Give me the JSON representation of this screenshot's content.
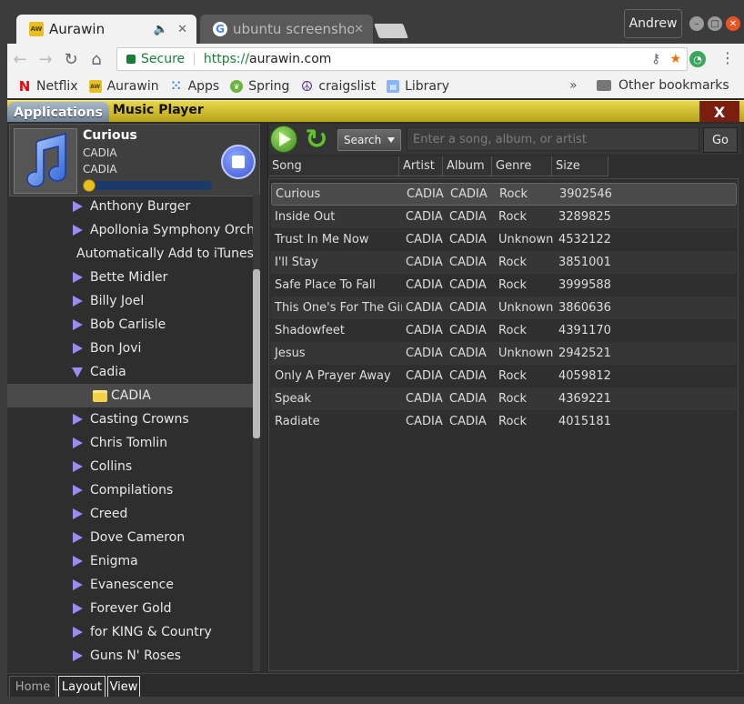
{
  "browser": {
    "tabs": [
      {
        "title": "Aurawin",
        "favicon": "aurawin-icon",
        "active": true
      },
      {
        "title": "ubuntu screenshot",
        "favicon": "google-icon",
        "active": false
      }
    ],
    "profile": "Andrew",
    "address": {
      "secure_label": "Secure",
      "scheme": "https://",
      "host": "aurawin.com"
    },
    "bookmarks": [
      "Netflix",
      "Aurawin",
      "Apps",
      "Spring",
      "craigslist",
      "Library"
    ],
    "bookmarks_more": "»",
    "other_bookmarks": "Other bookmarks"
  },
  "app": {
    "applications_label": "Applications",
    "title": "Music Player",
    "close_label": "X"
  },
  "now_playing": {
    "title": "Curious",
    "artist": "CADIA",
    "album": "CADIA",
    "progress": 0.02
  },
  "tree": [
    {
      "label": "Anthony Burger",
      "kind": "artist"
    },
    {
      "label": "Apollonia Symphony Orchestra",
      "kind": "artist"
    },
    {
      "label": "Automatically Add to iTunes",
      "kind": "folder"
    },
    {
      "label": "Bette Midler",
      "kind": "artist"
    },
    {
      "label": "Billy Joel",
      "kind": "artist"
    },
    {
      "label": "Bob Carlisle",
      "kind": "artist"
    },
    {
      "label": "Bon Jovi",
      "kind": "artist"
    },
    {
      "label": "Cadia",
      "kind": "artist-open"
    },
    {
      "label": "CADIA",
      "kind": "subfolder",
      "selected": true
    },
    {
      "label": "Casting Crowns",
      "kind": "artist"
    },
    {
      "label": "Chris Tomlin",
      "kind": "artist"
    },
    {
      "label": "Collins",
      "kind": "artist"
    },
    {
      "label": "Compilations",
      "kind": "artist"
    },
    {
      "label": "Creed",
      "kind": "artist"
    },
    {
      "label": "Dove Cameron",
      "kind": "artist"
    },
    {
      "label": "Enigma",
      "kind": "artist"
    },
    {
      "label": "Evanescence",
      "kind": "artist"
    },
    {
      "label": "Forever Gold",
      "kind": "artist"
    },
    {
      "label": "for KING & Country",
      "kind": "artist"
    },
    {
      "label": "Guns N' Roses",
      "kind": "artist"
    }
  ],
  "search": {
    "mode": "Search",
    "placeholder": "Enter a song, album, or artist",
    "go_label": "Go"
  },
  "table": {
    "columns": [
      "Song",
      "Artist",
      "Album",
      "Genre",
      "Size"
    ],
    "rows": [
      [
        "Curious",
        "CADIA",
        "CADIA",
        "Rock",
        "3902546"
      ],
      [
        "Inside Out",
        "CADIA",
        "CADIA",
        "Rock",
        "3289825"
      ],
      [
        "Trust In Me Now",
        "CADIA",
        "CADIA",
        "Unknown",
        "4532122"
      ],
      [
        "I'll Stay",
        "CADIA",
        "CADIA",
        "Rock",
        "3851001"
      ],
      [
        "Safe Place To Fall",
        "CADIA",
        "CADIA",
        "Rock",
        "3999588"
      ],
      [
        "This One's For The Girls",
        "CADIA",
        "CADIA",
        "Unknown",
        "3860636"
      ],
      [
        "Shadowfeet",
        "CADIA",
        "CADIA",
        "Rock",
        "4391170"
      ],
      [
        "Jesus",
        "CADIA",
        "CADIA",
        "Unknown",
        "2942521"
      ],
      [
        "Only A Prayer Away",
        "CADIA",
        "CADIA",
        "Rock",
        "4059812"
      ],
      [
        "Speak",
        "CADIA",
        "CADIA",
        "Rock",
        "4369221"
      ],
      [
        "Radiate",
        "CADIA",
        "CADIA",
        "Rock",
        "4015181"
      ]
    ],
    "selected_row": 0
  },
  "bottom_tabs": [
    "Home",
    "Layout",
    "View"
  ]
}
